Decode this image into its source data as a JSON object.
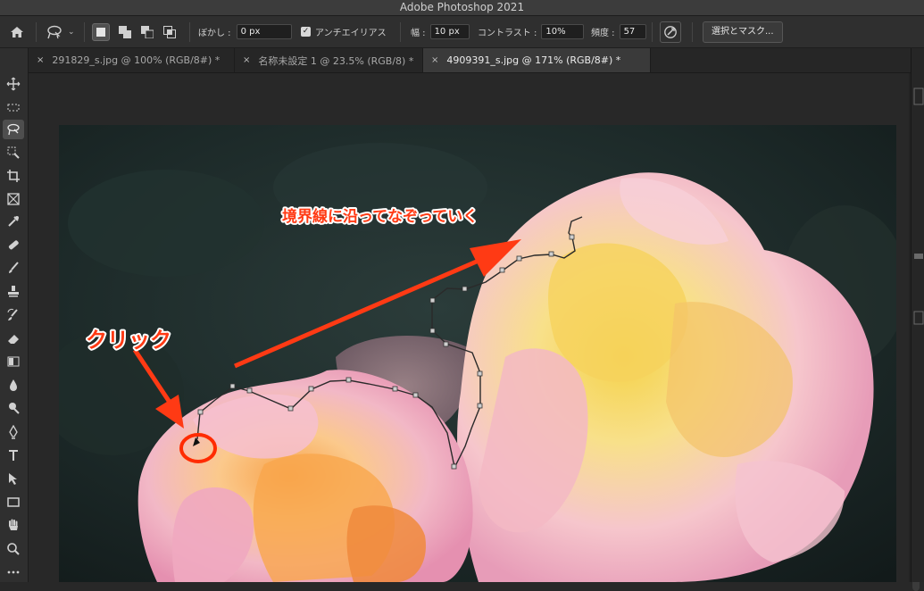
{
  "app": {
    "title": "Adobe Photoshop 2021"
  },
  "options_bar": {
    "feather_label": "ぼかし :",
    "feather_value": "0 px",
    "antialias_label": "アンチエイリアス",
    "width_label": "幅 :",
    "width_value": "10 px",
    "contrast_label": "コントラスト :",
    "contrast_value": "10%",
    "frequency_label": "頻度 :",
    "frequency_value": "57",
    "select_mask_label": "選択とマスク..."
  },
  "tabs": [
    {
      "label": "291829_s.jpg @ 100% (RGB/8#) *",
      "active": false
    },
    {
      "label": "名称未設定 1 @ 23.5% (RGB/8) *",
      "active": false
    },
    {
      "label": "4909391_s.jpg @ 171% (RGB/8#) *",
      "active": true
    }
  ],
  "tab_close_glyph": "×",
  "toolbar": {
    "tools": [
      "move-icon",
      "marquee-icon",
      "magnetic-lasso-icon",
      "quick-select-icon",
      "crop-icon",
      "frame-icon",
      "eyedropper-icon",
      "healing-icon",
      "brush-icon",
      "stamp-icon",
      "history-brush-icon",
      "eraser-icon",
      "gradient-icon",
      "blur-icon",
      "dodge-icon",
      "pen-icon",
      "type-icon",
      "path-select-icon",
      "rectangle-icon",
      "hand-icon",
      "zoom-icon",
      "more-icon"
    ],
    "active_tool": "magnetic-lasso-icon"
  },
  "canvas": {
    "annotation_click": "クリック",
    "annotation_trace": "境界線に沿ってなぞっていく",
    "annotation_color": "#ff3a14",
    "background_color": "#1d2b2a"
  }
}
